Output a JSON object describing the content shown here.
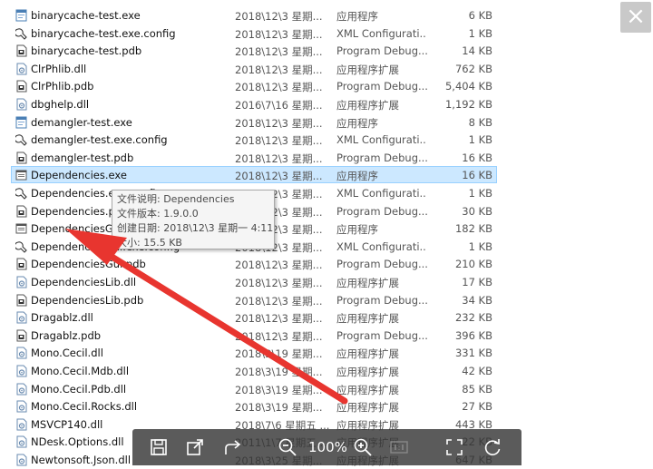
{
  "files": [
    {
      "name": "binarycache-test.exe",
      "date": "2018\\12\\3 星期...",
      "type": "应用程序",
      "size": "6 KB",
      "icon": "exe-icon"
    },
    {
      "name": "binarycache-test.exe.config",
      "date": "2018\\12\\3 星期...",
      "type": "XML Configurati...",
      "size": "1 KB",
      "icon": "config-icon"
    },
    {
      "name": "binarycache-test.pdb",
      "date": "2018\\12\\3 星期...",
      "type": "Program Debug...",
      "size": "14 KB",
      "icon": "pdb-icon"
    },
    {
      "name": "ClrPhlib.dll",
      "date": "2018\\12\\3 星期...",
      "type": "应用程序扩展",
      "size": "762 KB",
      "icon": "dll-icon"
    },
    {
      "name": "ClrPhlib.pdb",
      "date": "2018\\12\\3 星期...",
      "type": "Program Debug...",
      "size": "5,404 KB",
      "icon": "pdb-icon"
    },
    {
      "name": "dbghelp.dll",
      "date": "2016\\7\\16 星期...",
      "type": "应用程序扩展",
      "size": "1,192 KB",
      "icon": "dll-icon"
    },
    {
      "name": "demangler-test.exe",
      "date": "2018\\12\\3 星期...",
      "type": "应用程序",
      "size": "8 KB",
      "icon": "exe-icon"
    },
    {
      "name": "demangler-test.exe.config",
      "date": "2018\\12\\3 星期...",
      "type": "XML Configurati...",
      "size": "1 KB",
      "icon": "config-icon"
    },
    {
      "name": "demangler-test.pdb",
      "date": "2018\\12\\3 星期...",
      "type": "Program Debug...",
      "size": "16 KB",
      "icon": "pdb-icon"
    },
    {
      "name": "Dependencies.exe",
      "date": "2018\\12\\3 星期...",
      "type": "应用程序",
      "size": "16 KB",
      "icon": "app-window-icon",
      "selected": true
    },
    {
      "name": "Dependencies.exe.config",
      "date": "2018\\12\\3 星期...",
      "type": "XML Configurati...",
      "size": "1 KB",
      "icon": "config-icon"
    },
    {
      "name": "Dependencies.pdb",
      "date": "2018\\12\\3 星期...",
      "type": "Program Debug...",
      "size": "30 KB",
      "icon": "pdb-icon"
    },
    {
      "name": "DependenciesGui.exe",
      "date": "2018\\12\\3 星期...",
      "type": "应用程序",
      "size": "182 KB",
      "icon": "app-window-icon"
    },
    {
      "name": "DependenciesGui.exe.config",
      "date": "2018\\12\\3 星期...",
      "type": "XML Configurati...",
      "size": "1 KB",
      "icon": "config-icon"
    },
    {
      "name": "DependenciesGui.pdb",
      "date": "2018\\12\\3 星期...",
      "type": "Program Debug...",
      "size": "210 KB",
      "icon": "pdb-icon"
    },
    {
      "name": "DependenciesLib.dll",
      "date": "2018\\12\\3 星期...",
      "type": "应用程序扩展",
      "size": "17 KB",
      "icon": "dll-icon"
    },
    {
      "name": "DependenciesLib.pdb",
      "date": "2018\\12\\3 星期...",
      "type": "Program Debug...",
      "size": "34 KB",
      "icon": "pdb-icon"
    },
    {
      "name": "Dragablz.dll",
      "date": "2018\\12\\3 星期...",
      "type": "应用程序扩展",
      "size": "232 KB",
      "icon": "dll-icon"
    },
    {
      "name": "Dragablz.pdb",
      "date": "2018\\12\\3 星期...",
      "type": "Program Debug...",
      "size": "396 KB",
      "icon": "pdb-icon"
    },
    {
      "name": "Mono.Cecil.dll",
      "date": "2018\\3\\19 星期...",
      "type": "应用程序扩展",
      "size": "331 KB",
      "icon": "dll-icon"
    },
    {
      "name": "Mono.Cecil.Mdb.dll",
      "date": "2018\\3\\19 星期...",
      "type": "应用程序扩展",
      "size": "42 KB",
      "icon": "dll-icon"
    },
    {
      "name": "Mono.Cecil.Pdb.dll",
      "date": "2018\\3\\19 星期...",
      "type": "应用程序扩展",
      "size": "85 KB",
      "icon": "dll-icon"
    },
    {
      "name": "Mono.Cecil.Rocks.dll",
      "date": "2018\\3\\19 星期...",
      "type": "应用程序扩展",
      "size": "27 KB",
      "icon": "dll-icon"
    },
    {
      "name": "MSVCP140.dll",
      "date": "2018\\7\\6 星期五 ...",
      "type": "应用程序扩展",
      "size": "443 KB",
      "icon": "dll-icon"
    },
    {
      "name": "NDesk.Options.dll",
      "date": "2011\\1\\7 星期五...",
      "type": "应用程序扩展",
      "size": "22 KB",
      "icon": "dll-icon"
    },
    {
      "name": "Newtonsoft.Json.dll",
      "date": "2018\\3\\25 星期...",
      "type": "应用程序扩展",
      "size": "647 KB",
      "icon": "dll-icon"
    }
  ],
  "tooltip": {
    "line1": "文件说明: Dependencies",
    "line2": "文件版本: 1.9.0.0",
    "line3": "创建日期: 2018\\12\\3 星期一 4:11",
    "line4": "大小: 15.5 KB"
  },
  "viewer": {
    "close_label": "×",
    "zoom_label": "100%",
    "tools": [
      "save-icon",
      "open-external-icon",
      "share-icon",
      "zoom-out-icon",
      "zoom-in-icon",
      "actual-size-icon",
      "fit-screen-icon",
      "rotate-icon"
    ]
  },
  "colors": {
    "selection": "#cce8ff",
    "arrow": "#e8352f",
    "toolbar": "#373737"
  }
}
